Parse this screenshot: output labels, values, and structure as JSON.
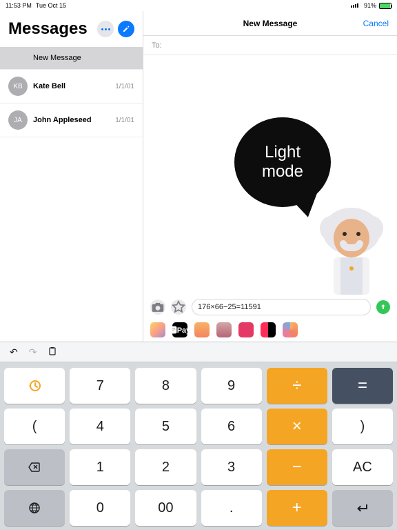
{
  "statusbar": {
    "time": "11:53 PM",
    "date": "Tue Oct 15",
    "battery_pct": "91%"
  },
  "sidebar": {
    "title": "Messages",
    "items": [
      {
        "label": "New Message",
        "initials": "",
        "date": ""
      },
      {
        "label": "Kate Bell",
        "initials": "KB",
        "date": "1/1/01"
      },
      {
        "label": "John Appleseed",
        "initials": "JA",
        "date": "1/1/01"
      }
    ]
  },
  "content": {
    "header_title": "New Message",
    "cancel": "Cancel",
    "to_label": "To:",
    "bubble_line1": "Light",
    "bubble_line2": "mode",
    "input_value": "176×66−25=11591"
  },
  "apprail": {
    "pay": "🅿Pay"
  },
  "toolbar": {
    "undo": "↶",
    "redo": "↷",
    "paste": "📋"
  },
  "keys": {
    "r1": [
      "",
      "7",
      "8",
      "9",
      "÷",
      "="
    ],
    "r2": [
      "(",
      "4",
      "5",
      "6",
      "×",
      ")"
    ],
    "r3": [
      "",
      "1",
      "2",
      "3",
      "−",
      "AC"
    ],
    "r4": [
      "",
      "0",
      "00",
      ".",
      "+",
      "↵"
    ]
  },
  "icons": {
    "history": "history-icon",
    "globe": "globe-icon",
    "backspace": "backspace-icon"
  }
}
